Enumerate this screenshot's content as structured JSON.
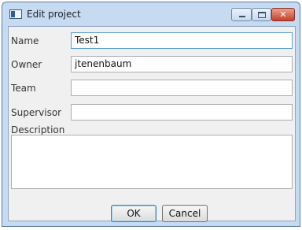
{
  "window": {
    "title": "Edit project"
  },
  "form": {
    "name": {
      "label": "Name",
      "value": "Test1"
    },
    "owner": {
      "label": "Owner",
      "value": "jtenenbaum"
    },
    "team": {
      "label": "Team",
      "value": ""
    },
    "supervisor": {
      "label": "Supervisor",
      "value": ""
    },
    "description": {
      "label": "Description",
      "value": ""
    }
  },
  "buttons": {
    "ok": "OK",
    "cancel": "Cancel"
  },
  "icons": {
    "app": "window-app-icon",
    "minimize": "minimize-icon",
    "maximize": "maximize-icon",
    "close": "close-icon"
  }
}
